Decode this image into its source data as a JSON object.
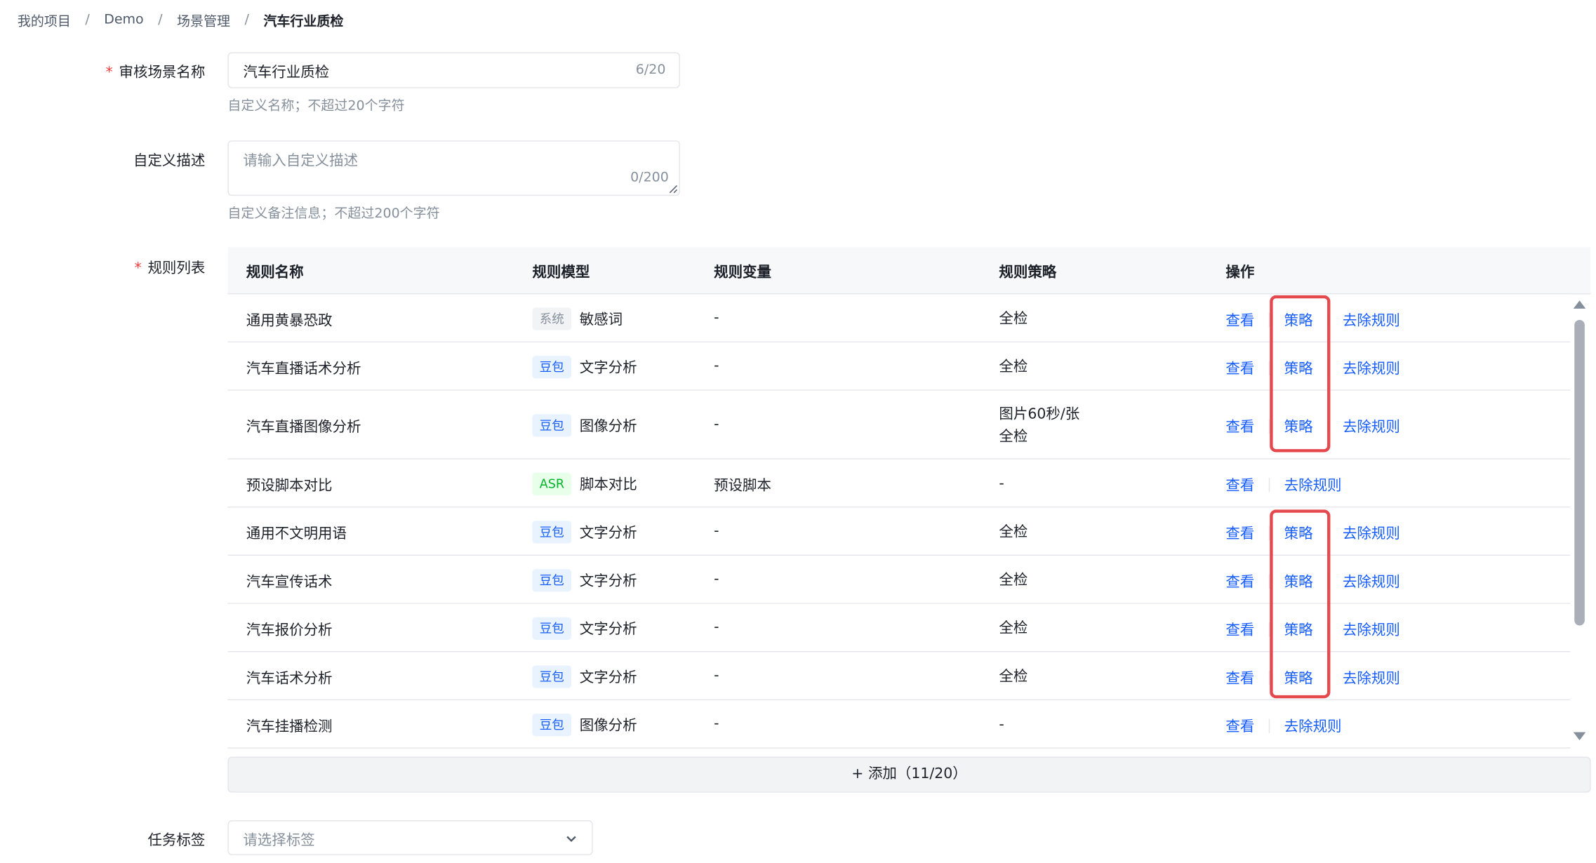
{
  "breadcrumb": {
    "items": [
      "我的项目",
      "Demo",
      "场景管理",
      "汽车行业质检"
    ],
    "separator": "/"
  },
  "form": {
    "scene_name": {
      "label": "审核场景名称",
      "required_mark": "*",
      "value": "汽车行业质检",
      "counter": "6/20",
      "hint": "自定义名称；不超过20个字符"
    },
    "description": {
      "label": "自定义描述",
      "placeholder": "请输入自定义描述",
      "counter": "0/200",
      "hint": "自定义备注信息；不超过200个字符"
    },
    "rules": {
      "label": "规则列表",
      "required_mark": "*",
      "columns": [
        "规则名称",
        "规则模型",
        "规则变量",
        "规则策略",
        "操作"
      ],
      "rows": [
        {
          "name": "通用黄暴恐政",
          "model_tag": "系统",
          "model_tag_color": "gray",
          "model": "敏感词",
          "variable": "-",
          "strategy": [
            "全检"
          ],
          "actions": [
            "查看",
            "策略",
            "去除规则"
          ]
        },
        {
          "name": "汽车直播话术分析",
          "model_tag": "豆包",
          "model_tag_color": "blue",
          "model": "文字分析",
          "variable": "-",
          "strategy": [
            "全检"
          ],
          "actions": [
            "查看",
            "策略",
            "去除规则"
          ]
        },
        {
          "name": "汽车直播图像分析",
          "model_tag": "豆包",
          "model_tag_color": "blue",
          "model": "图像分析",
          "variable": "-",
          "strategy": [
            "图片60秒/张",
            "全检"
          ],
          "actions": [
            "查看",
            "策略",
            "去除规则"
          ]
        },
        {
          "name": "预设脚本对比",
          "model_tag": "ASR",
          "model_tag_color": "green",
          "model": "脚本对比",
          "variable": "预设脚本",
          "strategy": [
            "-"
          ],
          "actions": [
            "查看",
            "去除规则"
          ]
        },
        {
          "name": "通用不文明用语",
          "model_tag": "豆包",
          "model_tag_color": "blue",
          "model": "文字分析",
          "variable": "-",
          "strategy": [
            "全检"
          ],
          "actions": [
            "查看",
            "策略",
            "去除规则"
          ]
        },
        {
          "name": "汽车宣传话术",
          "model_tag": "豆包",
          "model_tag_color": "blue",
          "model": "文字分析",
          "variable": "-",
          "strategy": [
            "全检"
          ],
          "actions": [
            "查看",
            "策略",
            "去除规则"
          ]
        },
        {
          "name": "汽车报价分析",
          "model_tag": "豆包",
          "model_tag_color": "blue",
          "model": "文字分析",
          "variable": "-",
          "strategy": [
            "全检"
          ],
          "actions": [
            "查看",
            "策略",
            "去除规则"
          ]
        },
        {
          "name": "汽车话术分析",
          "model_tag": "豆包",
          "model_tag_color": "blue",
          "model": "文字分析",
          "variable": "-",
          "strategy": [
            "全检"
          ],
          "actions": [
            "查看",
            "策略",
            "去除规则"
          ]
        },
        {
          "name": "汽车挂播检测",
          "model_tag": "豆包",
          "model_tag_color": "blue",
          "model": "图像分析",
          "variable": "-",
          "strategy": [
            "-"
          ],
          "actions": [
            "查看",
            "去除规则"
          ]
        }
      ],
      "add_button": "+ 添加（11/20）"
    },
    "task_tags": {
      "label": "任务标签",
      "placeholder": "请选择标签"
    }
  },
  "colors": {
    "link": "#165dff",
    "required": "#f53f3f",
    "highlight_box": "#e5484d",
    "tag_gray_bg": "#f2f3f5",
    "tag_blue_bg": "#e8f3ff",
    "tag_green_bg": "#e8ffea"
  },
  "icons": {
    "select_arrow": "chevron-down-icon",
    "scroll_up": "scroll-up-arrow-icon",
    "scroll_down": "scroll-down-arrow-icon",
    "textarea_resize": "resize-grip-icon"
  }
}
